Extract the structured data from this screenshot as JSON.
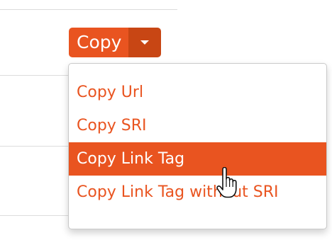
{
  "split_button": {
    "label": "Copy"
  },
  "dropdown": {
    "items": [
      {
        "label": "Copy Url",
        "active": false
      },
      {
        "label": "Copy SRI",
        "active": false
      },
      {
        "label": "Copy Link Tag",
        "active": true
      },
      {
        "label": "Copy Link Tag without SRI",
        "active": false
      }
    ]
  },
  "colors": {
    "accent": "#e95420",
    "accent_dark": "#c84614",
    "divider": "#dcdcdc"
  },
  "icons": {
    "caret": "caret-down-icon",
    "cursor": "hand-pointer-icon"
  }
}
